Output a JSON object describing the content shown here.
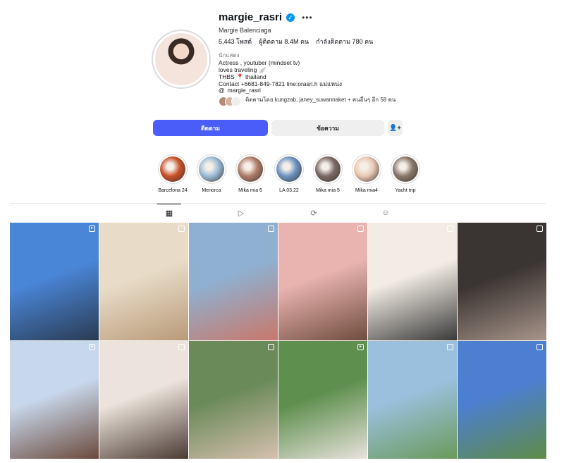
{
  "profile": {
    "username": "margie_rasri",
    "full_name": "Margie Balenciaga",
    "stats": {
      "posts": "5,443 โพสต์",
      "followers": "ผู้ติดตาม 8.4M คน",
      "following": "กำลังติดตาม 780 คน"
    },
    "category": "นักแสดง",
    "bio": [
      "Actress , youtuber (mindset tv)",
      "loves traveling 🪽",
      "THBS 📍 thailand",
      "Contact +6681-849-7821 line:orasri.h แม่แหน่ง"
    ],
    "threads_handle": "margie_rasri",
    "followed_by": "ติดตามโดย kungzab, janey_suwannaket + คนอื่นๆ อีก 58 คน"
  },
  "actions": {
    "follow": "ติดตาม",
    "message": "ข้อความ",
    "suggest_icon": "person-plus-icon"
  },
  "highlights": [
    {
      "label": "Barcelona 24",
      "color": "#c9512a"
    },
    {
      "label": "Menorca",
      "color": "#9bbcd6"
    },
    {
      "label": "Mika mia 6",
      "color": "#b07d69"
    },
    {
      "label": "LA 03.22",
      "color": "#6d94c2"
    },
    {
      "label": "Mika mia 5",
      "color": "#7b6a64"
    },
    {
      "label": "Mika mia4",
      "color": "#e9c8b2"
    },
    {
      "label": "Yacht trip",
      "color": "#8a7a6c"
    }
  ],
  "tabs": [
    {
      "name": "posts-grid-icon",
      "glyph": "▦"
    },
    {
      "name": "reels-icon",
      "glyph": "▷"
    },
    {
      "name": "reposts-icon",
      "glyph": "⟳"
    },
    {
      "name": "tagged-icon",
      "glyph": "☺"
    }
  ],
  "posts": [
    {
      "colors": [
        "#4a86d8",
        "#2a3b52"
      ],
      "badge": "reel"
    },
    {
      "colors": [
        "#e8dcc8",
        "#b99a78"
      ],
      "badge": "carousel"
    },
    {
      "colors": [
        "#8fb0d0",
        "#c9786a"
      ],
      "badge": "carousel"
    },
    {
      "colors": [
        "#e9b3b0",
        "#6e4c3d"
      ],
      "badge": "carousel"
    },
    {
      "colors": [
        "#f2ece4",
        "#3a3a3a"
      ],
      "badge": "carousel"
    },
    {
      "colors": [
        "#3a3432",
        "#a8958a"
      ],
      "badge": "carousel"
    },
    {
      "colors": [
        "#c8d8ec",
        "#6b4a3c"
      ],
      "badge": "reel"
    },
    {
      "colors": [
        "#ece4dc",
        "#4a3a32"
      ],
      "badge": "carousel"
    },
    {
      "colors": [
        "#6b8a5a",
        "#d6c0ae"
      ],
      "badge": "carousel"
    },
    {
      "colors": [
        "#5e8f4e",
        "#e8e2dc"
      ],
      "badge": "reel"
    },
    {
      "colors": [
        "#9bc0de",
        "#6a9a5a"
      ],
      "badge": "carousel"
    },
    {
      "colors": [
        "#4c7fcf",
        "#5f8c48"
      ],
      "badge": "carousel"
    }
  ]
}
